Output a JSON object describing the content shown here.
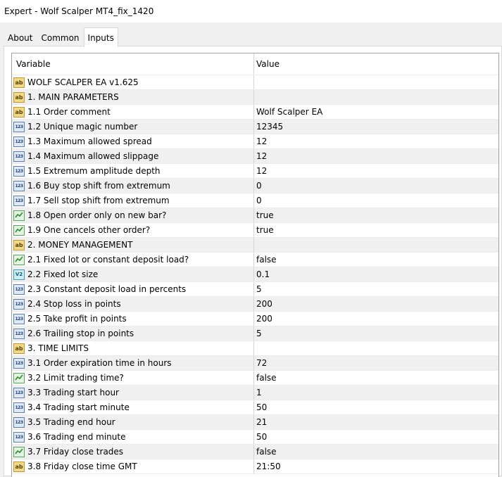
{
  "window": {
    "title": "Expert - Wolf Scalper MT4_fix_1420"
  },
  "tabs": [
    {
      "label": "About",
      "active": false
    },
    {
      "label": "Common",
      "active": false
    },
    {
      "label": "Inputs",
      "active": true
    }
  ],
  "grid": {
    "headers": {
      "variable": "Variable",
      "value": "Value"
    },
    "rows": [
      {
        "icon": "ab",
        "variable": "WOLF SCALPER EA v1.625",
        "value": ""
      },
      {
        "icon": "ab",
        "variable": "1. MAIN PARAMETERS",
        "value": ""
      },
      {
        "icon": "ab",
        "variable": "1.1 Order comment",
        "value": "Wolf Scalper EA"
      },
      {
        "icon": "123",
        "variable": "1.2 Unique magic number",
        "value": "12345"
      },
      {
        "icon": "123",
        "variable": "1.3 Maximum allowed spread",
        "value": "12"
      },
      {
        "icon": "123",
        "variable": "1.4 Maximum allowed slippage",
        "value": "12"
      },
      {
        "icon": "123",
        "variable": "1.5 Extremum amplitude depth",
        "value": "12"
      },
      {
        "icon": "123",
        "variable": "1.6 Buy stop shift from extremum",
        "value": "0"
      },
      {
        "icon": "123",
        "variable": "1.7 Sell stop shift from extremum",
        "value": "0"
      },
      {
        "icon": "bool",
        "variable": "1.8 Open order only on new bar?",
        "value": "true"
      },
      {
        "icon": "bool",
        "variable": "1.9 One cancels other order?",
        "value": "true"
      },
      {
        "icon": "ab",
        "variable": "2. MONEY MANAGEMENT",
        "value": ""
      },
      {
        "icon": "bool",
        "variable": "2.1 Fixed lot or constant deposit load?",
        "value": "false"
      },
      {
        "icon": "v2",
        "variable": "2.2 Fixed lot size",
        "value": "0.1"
      },
      {
        "icon": "123",
        "variable": "2.3 Constant deposit load in percents",
        "value": "5"
      },
      {
        "icon": "123",
        "variable": "2.4 Stop loss in points",
        "value": "200"
      },
      {
        "icon": "123",
        "variable": "2.5 Take profit in points",
        "value": "200"
      },
      {
        "icon": "123",
        "variable": "2.6 Trailing stop in points",
        "value": "5"
      },
      {
        "icon": "ab",
        "variable": "3. TIME LIMITS",
        "value": ""
      },
      {
        "icon": "123",
        "variable": "3.1 Order expiration time in hours",
        "value": "72"
      },
      {
        "icon": "bool",
        "variable": "3.2 Limit trading time?",
        "value": "false"
      },
      {
        "icon": "123",
        "variable": "3.3 Trading start hour",
        "value": "1"
      },
      {
        "icon": "123",
        "variable": "3.4 Trading start minute",
        "value": "50"
      },
      {
        "icon": "123",
        "variable": "3.5 Trading end hour",
        "value": "21"
      },
      {
        "icon": "123",
        "variable": "3.6 Trading end minute",
        "value": "50"
      },
      {
        "icon": "bool",
        "variable": "3.7 Friday close trades",
        "value": "false"
      },
      {
        "icon": "ab",
        "variable": "3.8 Friday close time GMT",
        "value": "21:50"
      }
    ]
  }
}
